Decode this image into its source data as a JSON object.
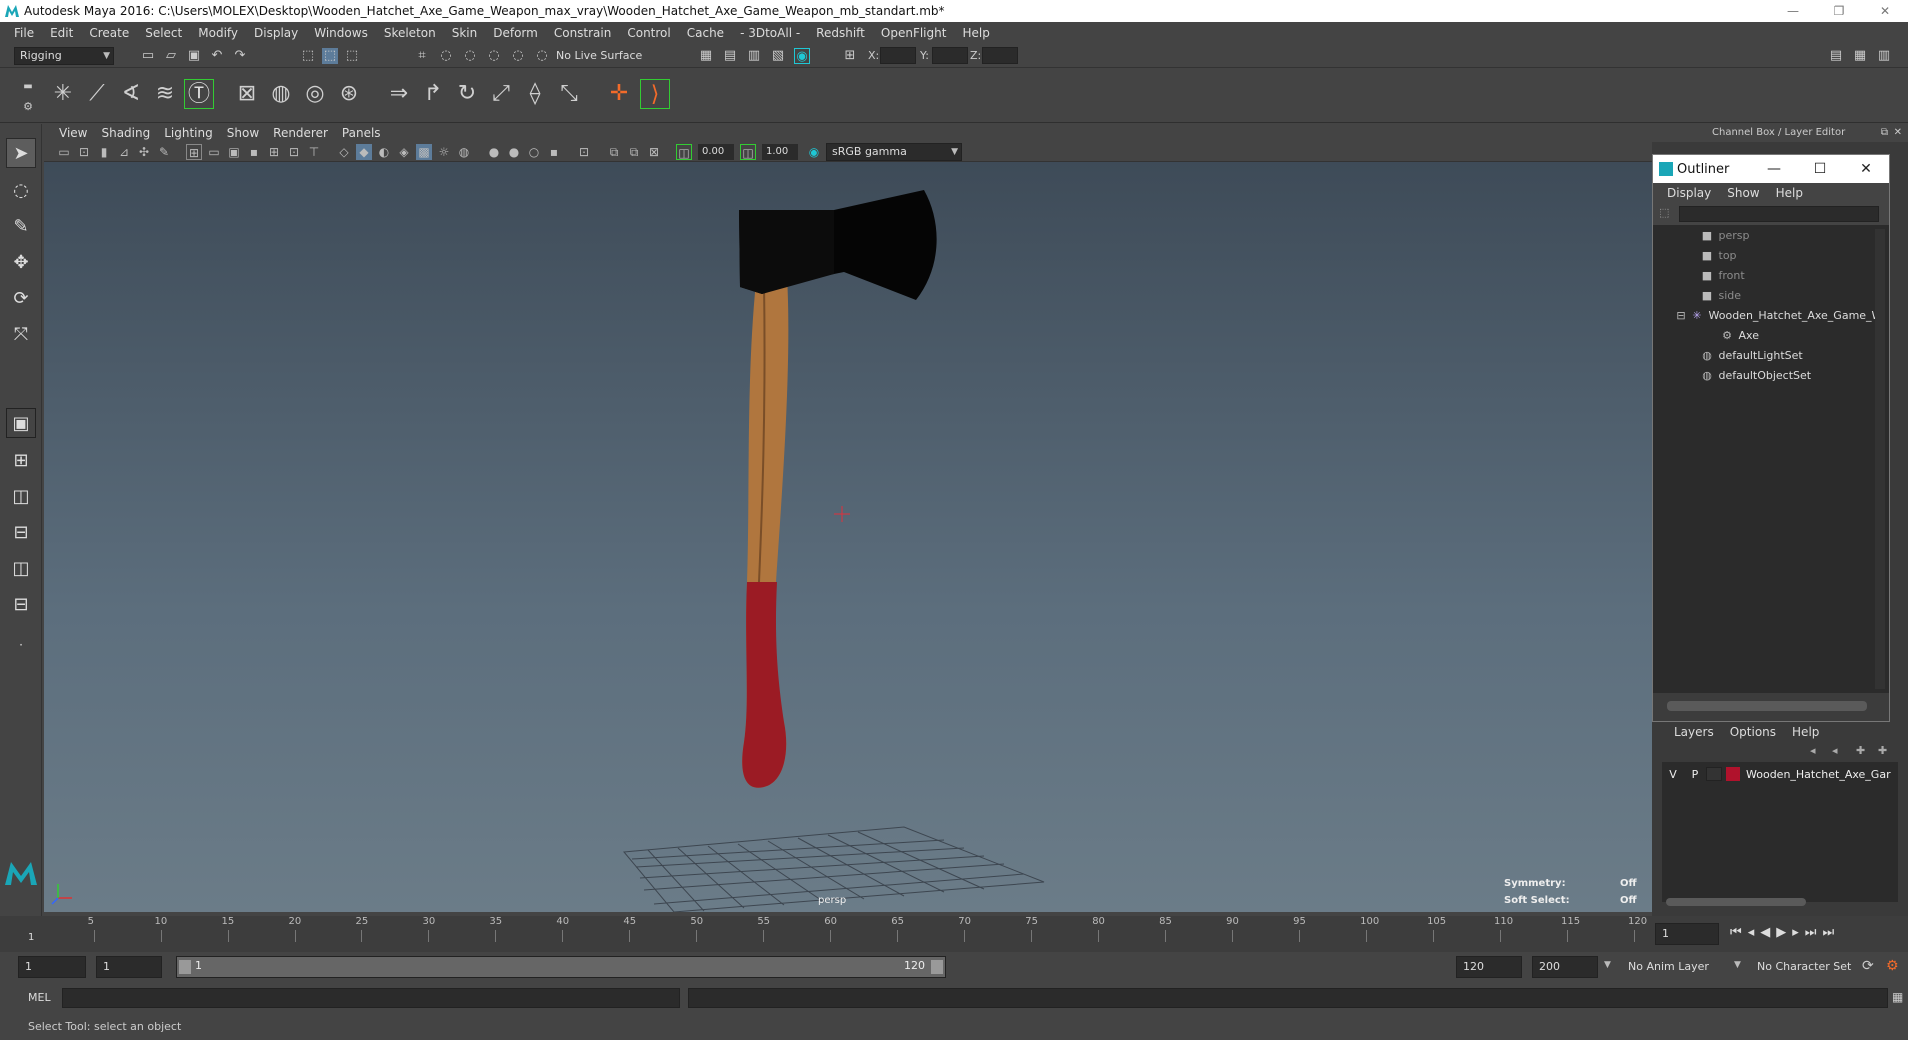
{
  "window": {
    "title": "Autodesk Maya 2016: C:\\Users\\MOLEX\\Desktop\\Wooden_Hatchet_Axe_Game_Weapon_max_vray\\Wooden_Hatchet_Axe_Game_Weapon_mb_standart.mb*",
    "min": "—",
    "restore": "❐",
    "close": "✕"
  },
  "menubar": [
    "File",
    "Edit",
    "Create",
    "Select",
    "Modify",
    "Display",
    "Windows",
    "Skeleton",
    "Skin",
    "Deform",
    "Constrain",
    "Control",
    "Cache",
    "- 3DtoAll -",
    "Redshift",
    "OpenFlight",
    "Help"
  ],
  "status": {
    "menu_set": "Rigging",
    "live_surface": "No Live Surface",
    "x_label": "X:",
    "y_label": "Y:",
    "z_label": "Z:"
  },
  "viewport": {
    "menu": [
      "View",
      "Shading",
      "Lighting",
      "Show",
      "Renderer",
      "Panels"
    ],
    "exposure": "0.00",
    "gamma": "1.00",
    "color_space": "sRGB gamma",
    "camera_label": "persp",
    "symmetry_label": "Symmetry:",
    "symmetry_value": "Off",
    "soft_select_label": "Soft Select:",
    "soft_select_value": "Off"
  },
  "right_panel": {
    "header": "Channel Box / Layer Editor"
  },
  "outliner": {
    "title": "Outliner",
    "menu": [
      "Display",
      "Show",
      "Help"
    ],
    "nodes": [
      {
        "label": "persp",
        "type": "camera"
      },
      {
        "label": "top",
        "type": "camera"
      },
      {
        "label": "front",
        "type": "camera"
      },
      {
        "label": "side",
        "type": "camera"
      },
      {
        "label": "Wooden_Hatchet_Axe_Game_W",
        "type": "group"
      },
      {
        "label": "Axe",
        "type": "mesh"
      },
      {
        "label": "defaultLightSet",
        "type": "set"
      },
      {
        "label": "defaultObjectSet",
        "type": "set"
      }
    ]
  },
  "layers": {
    "menu": [
      "Layers",
      "Options",
      "Help"
    ],
    "row": {
      "v": "V",
      "p": "P",
      "name": "Wooden_Hatchet_Axe_Gar",
      "color": "#b0122c"
    }
  },
  "timeline": {
    "ticks": [
      "5",
      "10",
      "15",
      "20",
      "25",
      "30",
      "35",
      "40",
      "45",
      "50",
      "55",
      "60",
      "65",
      "70",
      "75",
      "80",
      "85",
      "90",
      "95",
      "100",
      "105",
      "110",
      "115",
      "120"
    ],
    "current_frame": "1",
    "start_frame_marker": "1"
  },
  "range": {
    "start": "1",
    "playback_start": "1",
    "slider_start": "1",
    "slider_end": "120",
    "playback_end": "120",
    "end": "200",
    "anim_layer": "No Anim Layer",
    "character_set": "No Character Set"
  },
  "cmdline": {
    "label": "MEL"
  },
  "helpline": {
    "text": "Select Tool: select an object"
  }
}
